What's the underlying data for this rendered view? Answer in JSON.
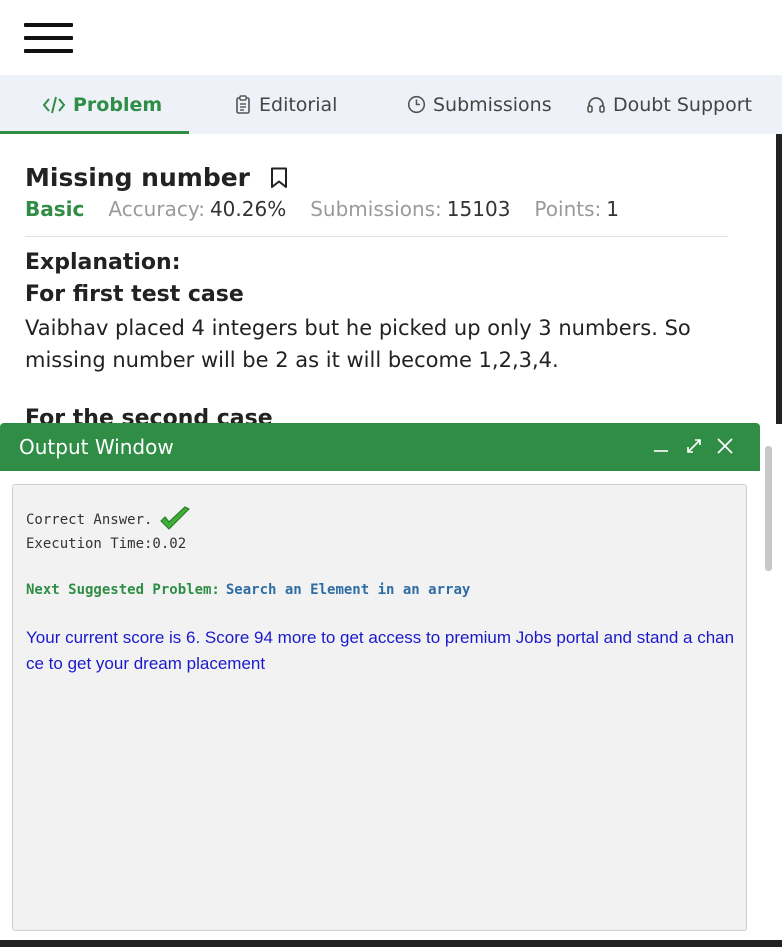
{
  "tabs": [
    {
      "label": "Problem",
      "icon": "code-icon",
      "active": true
    },
    {
      "label": "Editorial",
      "icon": "document-icon",
      "active": false
    },
    {
      "label": "Submissions",
      "icon": "clock-icon",
      "active": false
    },
    {
      "label": "Doubt Support",
      "icon": "headset-icon",
      "active": false
    }
  ],
  "problem": {
    "title": "Missing number",
    "difficulty": "Basic",
    "accuracy_label": "Accuracy:",
    "accuracy": "40.26%",
    "submissions_label": "Submissions:",
    "submissions": "15103",
    "points_label": "Points:",
    "points": "1"
  },
  "explanation": {
    "heading": "Explanation:",
    "case_heading": "For first test case",
    "text": "Vaibhav placed 4 integers but he picked up only 3 numbers. So missing number will be 2 as it will become 1,2,3,4.",
    "next_heading": "For the second case"
  },
  "output_window": {
    "title": "Output Window",
    "result": "Correct Answer.",
    "execution": "Execution Time:0.02",
    "next_label": "Next Suggested Problem:",
    "next_link": "Search an Element in an array",
    "score_text": "Your current score is 6. Score 94 more to get access to premium Jobs portal and stand a chance to get your dream placement"
  },
  "colors": {
    "brand_green": "#2f8d46",
    "tab_bar_bg": "#eef2f8",
    "link_blue": "#2e6da4",
    "score_blue": "#1a1acc"
  }
}
